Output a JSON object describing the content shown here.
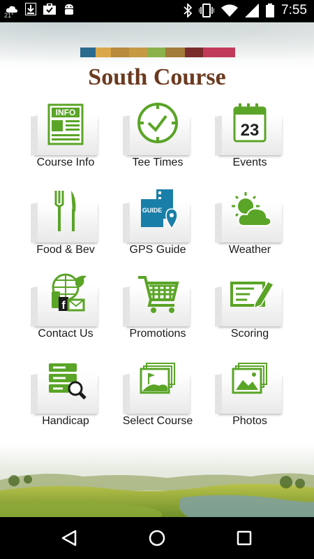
{
  "status_bar": {
    "temperature": "21°",
    "time": "7:55",
    "left_icons": [
      "weather-icon",
      "download-icon",
      "briefcase-icon",
      "android-debug-icon"
    ],
    "right_icons": [
      "bluetooth-icon",
      "vibrate-icon",
      "wifi-icon",
      "signal-icon",
      "battery-icon"
    ]
  },
  "header": {
    "title": "South Course",
    "logo_colors": [
      "#2a6b8f",
      "#d9a84a",
      "#b88a3c",
      "#8bb24a",
      "#7a2b2b",
      "#c23a5a"
    ]
  },
  "menu": [
    {
      "label": "Course Info",
      "icon": "info-newspaper-icon"
    },
    {
      "label": "Tee Times",
      "icon": "clock-icon"
    },
    {
      "label": "Events",
      "icon": "calendar-icon",
      "calendar_day": "23"
    },
    {
      "label": "Food & Bev",
      "icon": "fork-knife-icon"
    },
    {
      "label": "GPS Guide",
      "icon": "gps-guide-icon",
      "badge": "GUIDE"
    },
    {
      "label": "Weather",
      "icon": "sun-cloud-icon"
    },
    {
      "label": "Contact Us",
      "icon": "contact-icon"
    },
    {
      "label": "Promotions",
      "icon": "shopping-cart-icon"
    },
    {
      "label": "Scoring",
      "icon": "scorecard-pencil-icon"
    },
    {
      "label": "Handicap",
      "icon": "database-search-icon"
    },
    {
      "label": "Select Course",
      "icon": "course-photos-icon"
    },
    {
      "label": "Photos",
      "icon": "photos-icon"
    }
  ],
  "colors": {
    "accent_green": "#5aa427",
    "title_brown": "#6b3a1f"
  },
  "nav_bar": {
    "buttons": [
      "back-icon",
      "home-icon",
      "recents-icon"
    ]
  }
}
